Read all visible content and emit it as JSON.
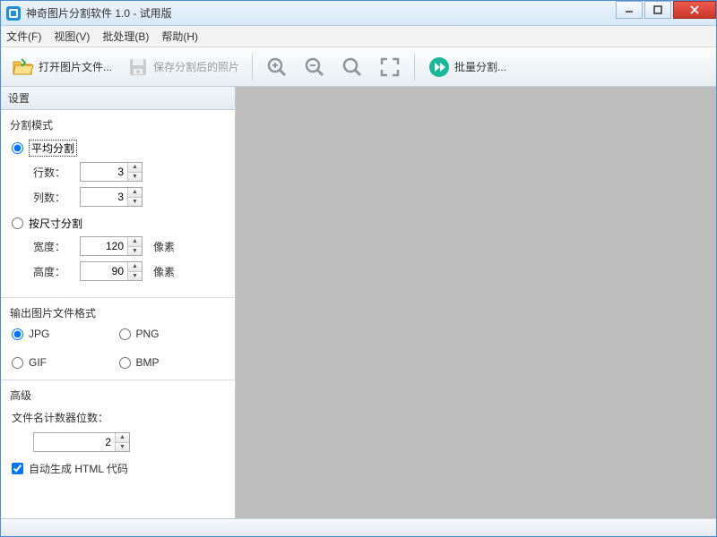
{
  "window": {
    "title": "神奇图片分割软件 1.0 - 试用版"
  },
  "menu": {
    "file": "文件(F)",
    "view": "视图(V)",
    "batch": "批处理(B)",
    "help": "帮助(H)"
  },
  "toolbar": {
    "open_label": "打开图片文件...",
    "save_label": "保存分割后的照片",
    "batch_label": "批量分割..."
  },
  "sidebar": {
    "header": "设置",
    "split_mode": {
      "title": "分割模式",
      "avg_label": "平均分割",
      "rows_label": "行数：",
      "rows_value": "3",
      "cols_label": "列数：",
      "cols_value": "3",
      "size_label": "按尺寸分割",
      "width_label": "宽度：",
      "width_value": "120",
      "height_label": "高度：",
      "height_value": "90",
      "unit": "像素",
      "selected": "avg"
    },
    "format": {
      "title": "输出图片文件格式",
      "jpg": "JPG",
      "png": "PNG",
      "gif": "GIF",
      "bmp": "BMP",
      "selected": "JPG"
    },
    "advanced": {
      "title": "高级",
      "counter_label": "文件名计数器位数：",
      "counter_value": "2",
      "autohtml_label": "自动生成 HTML 代码",
      "autohtml_checked": true
    }
  }
}
